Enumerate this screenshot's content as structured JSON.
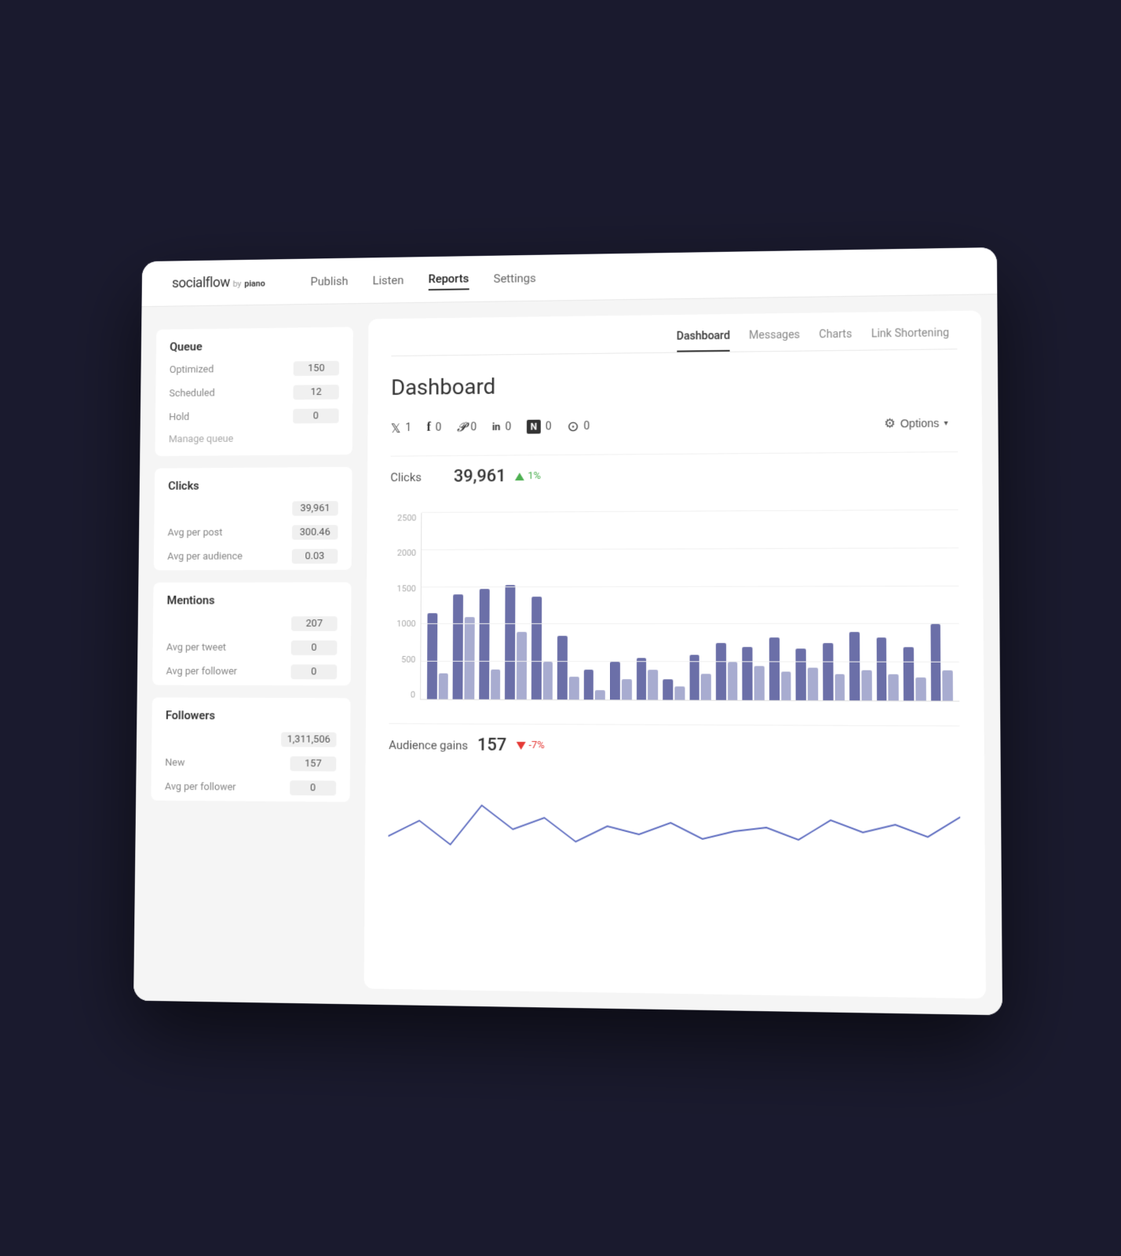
{
  "logo": {
    "main": "socialflow",
    "by": "by",
    "piano": "piano"
  },
  "nav": {
    "items": [
      {
        "label": "Publish",
        "active": false
      },
      {
        "label": "Listen",
        "active": false
      },
      {
        "label": "Reports",
        "active": true
      },
      {
        "label": "Settings",
        "active": false
      }
    ]
  },
  "sub_tabs": [
    {
      "label": "Dashboard",
      "active": true
    },
    {
      "label": "Messages",
      "active": false
    },
    {
      "label": "Charts",
      "active": false
    },
    {
      "label": "Link Shortening",
      "active": false
    }
  ],
  "page_title": "Dashboard",
  "social_accounts": [
    {
      "icon": "𝕏",
      "count": "1",
      "name": "twitter"
    },
    {
      "icon": "f",
      "count": "0",
      "name": "facebook"
    },
    {
      "icon": "𝓟",
      "count": "0",
      "name": "pinterest"
    },
    {
      "icon": "in",
      "count": "0",
      "name": "linkedin"
    },
    {
      "icon": "N",
      "count": "0",
      "name": "news"
    },
    {
      "icon": "⊙",
      "count": "0",
      "name": "instagram"
    }
  ],
  "options_label": "Options",
  "metrics": {
    "clicks": {
      "label": "Clicks",
      "value": "39,961",
      "change": "1%",
      "direction": "up"
    },
    "audience": {
      "label": "Audience gains",
      "value": "157",
      "change": "-7%",
      "direction": "down"
    }
  },
  "sidebar": {
    "queue": {
      "title": "Queue",
      "items": [
        {
          "label": "Optimized",
          "value": "150"
        },
        {
          "label": "Scheduled",
          "value": "12"
        },
        {
          "label": "Hold",
          "value": "0"
        }
      ],
      "manage": "Manage queue"
    },
    "clicks": {
      "title": "Clicks",
      "items": [
        {
          "label": "Avg per post",
          "value": "39,961"
        },
        {
          "label": "Avg per audience",
          "value": "300.46"
        },
        {
          "label": "",
          "value": "0.03"
        }
      ]
    },
    "mentions": {
      "title": "Mentions",
      "items": [
        {
          "label": "Avg per tweet",
          "value": "207"
        },
        {
          "label": "Avg per follower",
          "value": "0"
        },
        {
          "label": "",
          "value": "0"
        }
      ]
    },
    "followers": {
      "title": "Followers",
      "items": [
        {
          "label": "New",
          "value": "1,311,506"
        },
        {
          "label": "Avg per follower",
          "value": "157"
        },
        {
          "label": "",
          "value": "0"
        }
      ]
    }
  },
  "chart": {
    "y_labels": [
      "0",
      "500",
      "1000",
      "1500",
      "2000",
      "2500"
    ],
    "bars": [
      [
        1150,
        350
      ],
      [
        1400,
        1100
      ],
      [
        1480,
        400
      ],
      [
        1520,
        900
      ],
      [
        1380,
        500
      ],
      [
        850,
        300
      ],
      [
        400,
        120
      ],
      [
        500,
        280
      ],
      [
        550,
        400
      ],
      [
        280,
        180
      ],
      [
        600,
        350
      ],
      [
        750,
        500
      ],
      [
        700,
        450
      ],
      [
        820,
        380
      ],
      [
        680,
        420
      ],
      [
        750,
        350
      ],
      [
        900,
        400
      ],
      [
        820,
        350
      ],
      [
        700,
        300
      ],
      [
        1000,
        400
      ]
    ],
    "max": 2500
  }
}
